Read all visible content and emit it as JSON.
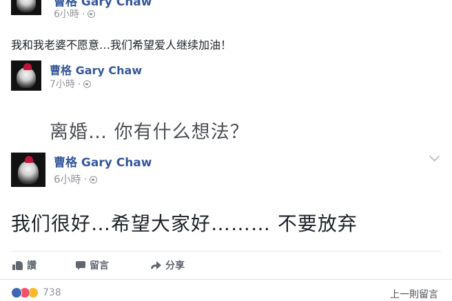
{
  "post1": {
    "author": "曹格 Gary Chaw",
    "time": "6小時",
    "text": "我和我老婆不愿意…我们希望爱人继续加油！"
  },
  "post2": {
    "author": "曹格 Gary Chaw",
    "time": "7小時",
    "text": "离婚… 你有什么想法？"
  },
  "post3": {
    "author": "曹格 Gary Chaw",
    "time": "6小時",
    "text": "我们很好…希望大家好……… 不要放弃"
  },
  "actions": {
    "like": "讚",
    "comment": "留言",
    "share": "分享"
  },
  "footer": {
    "count": "738",
    "right_label": "上一則留言"
  },
  "colors": {
    "author": "#365899",
    "meta": "#90949c",
    "action": "#606770"
  }
}
